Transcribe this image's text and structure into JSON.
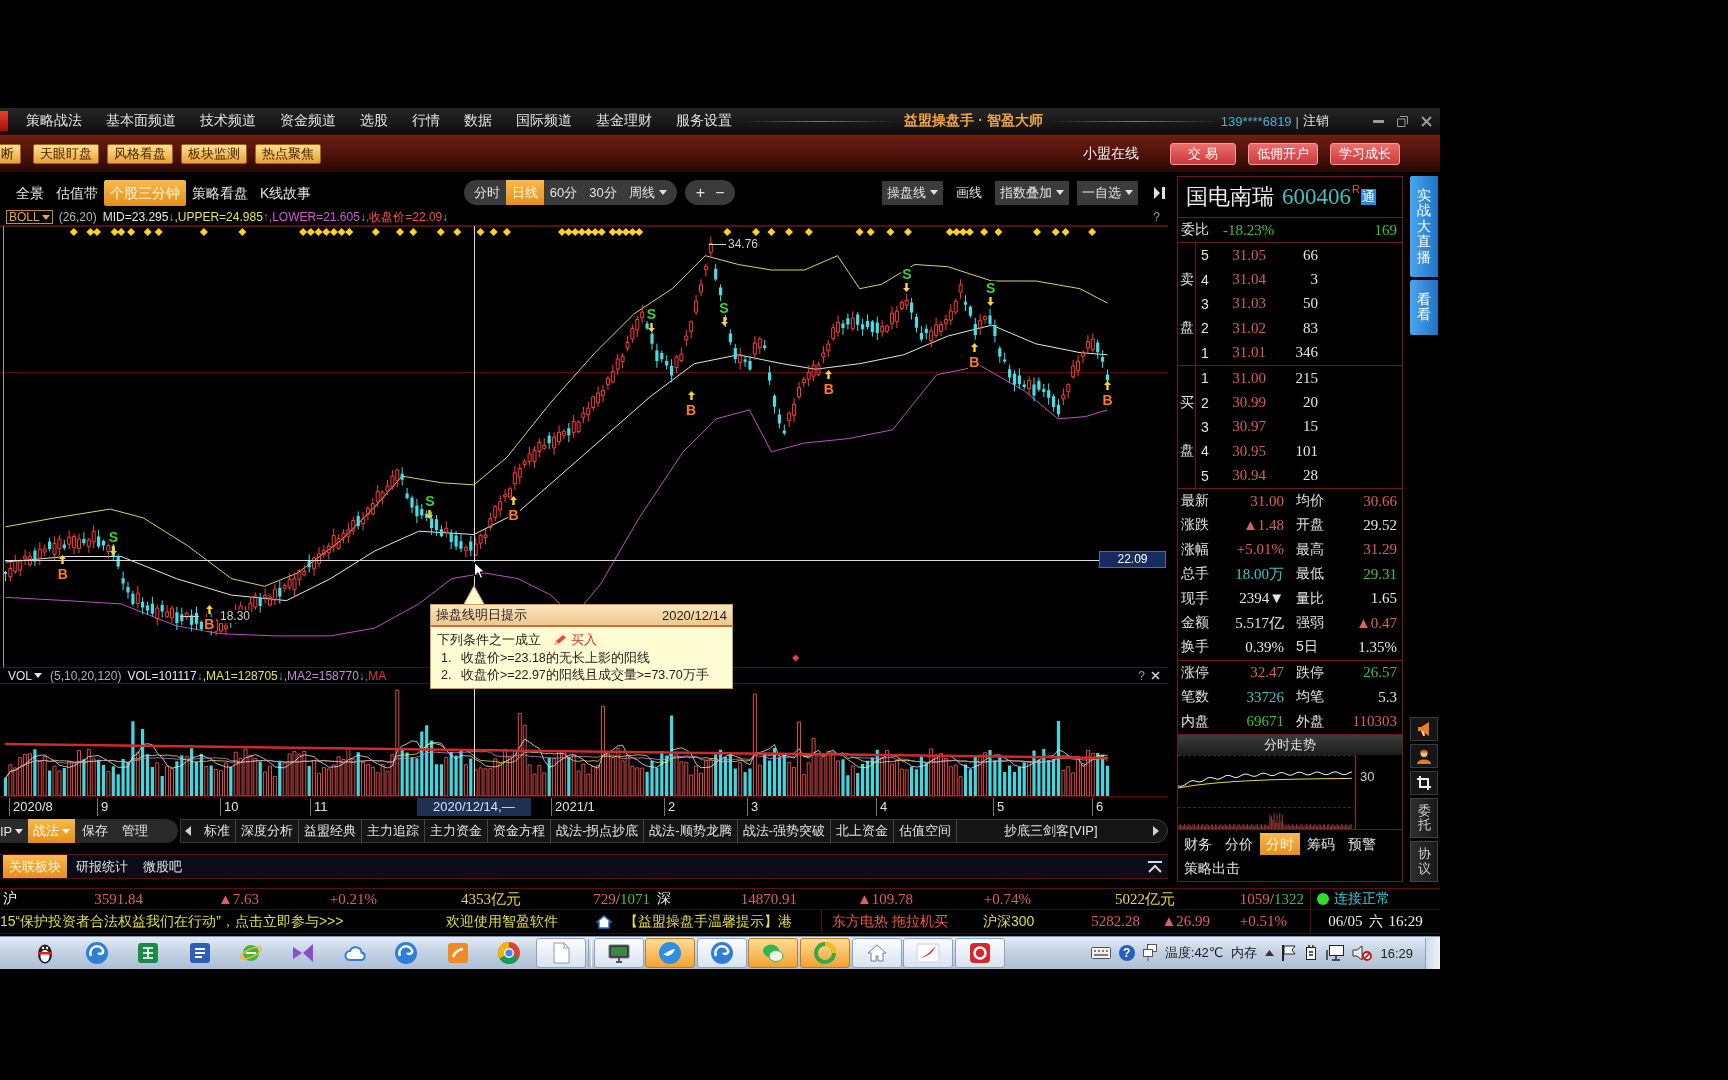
{
  "title_bar": {
    "menu": [
      "策略战法",
      "基本面频道",
      "技术频道",
      "资金频道",
      "选股",
      "行情",
      "数据",
      "国际频道",
      "基金理财",
      "服务设置"
    ],
    "title": "益盟操盘手 · 智盈大师",
    "account": "139****6819",
    "separator": "|",
    "logout": "注销"
  },
  "toolbar": {
    "left_buttons": [
      "断",
      "天眼盯盘",
      "风格看盘",
      "板块监测",
      "热点聚焦"
    ],
    "status": "小盟在线",
    "right_buttons": [
      "交 易",
      "低佣开户",
      "学习成长"
    ]
  },
  "view_tabs": [
    {
      "label": "全景",
      "selected": false
    },
    {
      "label": "估值带",
      "selected": false
    },
    {
      "label": "个股三分钟",
      "selected": true
    },
    {
      "label": "策略看盘",
      "selected": false
    },
    {
      "label": "K线故事",
      "selected": false
    }
  ],
  "period_tabs": [
    {
      "label": "分时",
      "selected": false,
      "dropdown": false
    },
    {
      "label": "日线",
      "selected": true,
      "dropdown": false
    },
    {
      "label": "60分",
      "selected": false,
      "dropdown": false
    },
    {
      "label": "30分",
      "selected": false,
      "dropdown": false
    },
    {
      "label": "周线",
      "selected": false,
      "dropdown": true
    }
  ],
  "zoom_buttons": [
    "+",
    "−"
  ],
  "chart_tools": [
    {
      "label": "操盘线",
      "dropdown": true
    },
    {
      "label": "画线",
      "dropdown": false
    },
    {
      "label": "指数叠加",
      "dropdown": true
    },
    {
      "label": "一自选",
      "dropdown": true
    }
  ],
  "indicator": {
    "name": "BOLL",
    "params": "(26,20)",
    "values": [
      {
        "text": "MID=23.295",
        "arrow": "↓",
        "rising": false,
        "color": "#e8e8e8"
      },
      {
        "text": ",UPPER=24.985",
        "arrow": "↑",
        "rising": true,
        "color": "#e6e35a"
      },
      {
        "text": ",LOWER=21.605",
        "arrow": "↓",
        "rising": false,
        "color": "#d35bd3"
      },
      {
        "text": ",收盘价=22.09",
        "arrow": "↓",
        "rising": false,
        "color": "#ff4a4a"
      }
    ],
    "help": "?"
  },
  "price_chart": {
    "high_label": "34.76",
    "low_label": "18.30",
    "crosshair_price": "22.09",
    "signals": [
      {
        "kind": "buy",
        "label": "B"
      },
      {
        "kind": "sell",
        "label": "S"
      },
      {
        "kind": "buy",
        "label": "B"
      },
      {
        "kind": "sell",
        "label": "S"
      },
      {
        "kind": "buy",
        "label": "B"
      },
      {
        "kind": "sell",
        "label": "S"
      },
      {
        "kind": "buy",
        "label": "B"
      },
      {
        "kind": "sell",
        "label": "S"
      },
      {
        "kind": "buy",
        "label": "B"
      },
      {
        "kind": "sell",
        "label": "S"
      },
      {
        "kind": "buy",
        "label": "B"
      },
      {
        "kind": "sell",
        "label": "S"
      },
      {
        "kind": "buy",
        "label": "B"
      }
    ]
  },
  "tooltip": {
    "title": "操盘线明日提示",
    "date": "2020/12/14",
    "condition": "下列条件之一成立",
    "action": "买入",
    "rules": [
      {
        "number": "1.",
        "text": "收盘价>=23.18的无长上影的阳线"
      },
      {
        "number": "2.",
        "text": "收盘价>=22.97的阳线且成交量>=73.70万手"
      }
    ]
  },
  "volume_indicator": {
    "name": "VOL",
    "params": "(5,10,20,120)",
    "values": [
      {
        "text": "VOL=101117",
        "arrow": "↓",
        "rising": false,
        "color": "#e8e8e8"
      },
      {
        "text": ",MA1=128705",
        "arrow": "↓",
        "rising": false,
        "color": "#e6e35a"
      },
      {
        "text": ",MA2=158770",
        "arrow": "↓",
        "rising": false,
        "color": "#c58ad8"
      },
      {
        "text": ",MA",
        "color": "#d04040"
      }
    ],
    "help": "?"
  },
  "date_axis": [
    {
      "label": "2020/8",
      "highlighted": false
    },
    {
      "label": "9",
      "highlighted": false
    },
    {
      "label": "10",
      "highlighted": false
    },
    {
      "label": "11",
      "highlighted": false
    },
    {
      "label": "2020/12/14,—",
      "highlighted": true
    },
    {
      "label": "2021/1",
      "highlighted": false
    },
    {
      "label": "2",
      "highlighted": false
    },
    {
      "label": "3",
      "highlighted": false
    },
    {
      "label": "4",
      "highlighted": false
    },
    {
      "label": "5",
      "highlighted": false
    },
    {
      "label": "6",
      "highlighted": false
    }
  ],
  "strategy_bar": {
    "modes": [
      {
        "label": "IP",
        "selected": false,
        "dropdown": true
      },
      {
        "label": "战法",
        "selected": true,
        "dropdown": true
      }
    ],
    "actions": [
      "保存",
      "管理"
    ],
    "tabs": [
      {
        "label": "标准",
        "selected": false
      },
      {
        "label": "深度分析",
        "selected": false
      },
      {
        "label": "益盟经典",
        "selected": false
      },
      {
        "label": "主力追踪",
        "selected": false
      },
      {
        "label": "主力资金",
        "selected": false
      },
      {
        "label": "资金方程",
        "selected": false
      },
      {
        "label": "战法-拐点抄底",
        "selected": false
      },
      {
        "label": "战法-顺势龙腾",
        "selected": false
      },
      {
        "label": "战法-强势突破",
        "selected": false
      },
      {
        "label": "北上资金",
        "selected": false
      },
      {
        "label": "估值空间",
        "selected": false
      },
      {
        "label": "抄底三剑客[VIP]",
        "selected": false
      }
    ]
  },
  "bottom_tabs": [
    {
      "label": "关联板块",
      "selected": true
    },
    {
      "label": "研报统计",
      "selected": false
    },
    {
      "label": "微股吧",
      "selected": false
    }
  ],
  "quote_panel": {
    "name": "国电南瑞",
    "code": "600406",
    "superscript": "R",
    "badge": "通",
    "ratio": {
      "label": "委比",
      "value": "-18.23%",
      "diff": "169",
      "rising": false
    },
    "sell_label": [
      "卖",
      "盘"
    ],
    "asks": [
      {
        "rank": "5",
        "price": "31.05",
        "volume": "66"
      },
      {
        "rank": "4",
        "price": "31.04",
        "volume": "3"
      },
      {
        "rank": "3",
        "price": "31.03",
        "volume": "50"
      },
      {
        "rank": "2",
        "price": "31.02",
        "volume": "83"
      },
      {
        "rank": "1",
        "price": "31.01",
        "volume": "346"
      }
    ],
    "buy_label": [
      "买",
      "盘"
    ],
    "bids": [
      {
        "rank": "1",
        "price": "31.00",
        "volume": "215"
      },
      {
        "rank": "2",
        "price": "30.99",
        "volume": "20"
      },
      {
        "rank": "3",
        "price": "30.97",
        "volume": "15"
      },
      {
        "rank": "4",
        "price": "30.95",
        "volume": "101"
      },
      {
        "rank": "5",
        "price": "30.94",
        "volume": "28"
      }
    ],
    "stats": [
      {
        "label": "最新",
        "value": "31.00",
        "color": "#e35d5d"
      },
      {
        "label": "均价",
        "value": "30.66",
        "color": "#e35d5d"
      },
      {
        "label": "涨跌",
        "value": "▲1.48",
        "color": "#e35d5d"
      },
      {
        "label": "开盘",
        "value": "29.52",
        "color": "#e6e6e6"
      },
      {
        "label": "涨幅",
        "value": "+5.01%",
        "color": "#e35d5d"
      },
      {
        "label": "最高",
        "value": "31.29",
        "color": "#e35d5d"
      },
      {
        "label": "总手",
        "value": "18.00万",
        "color": "#3fc6c6"
      },
      {
        "label": "最低",
        "value": "29.31",
        "color": "#3ec23e"
      },
      {
        "label": "现手",
        "value": "2394▼",
        "color": "#e6e6e6"
      },
      {
        "label": "量比",
        "value": "1.65",
        "color": "#e6e6e6"
      },
      {
        "label": "金额",
        "value": "5.517亿",
        "color": "#e6e6e6"
      },
      {
        "label": "强弱",
        "value": "▲0.47",
        "color": "#e35d5d"
      },
      {
        "label": "换手",
        "value": "0.39%",
        "color": "#e6e6e6"
      },
      {
        "label": "5日",
        "value": "1.35%",
        "color": "#e6e6e6"
      }
    ],
    "limits": [
      {
        "label": "涨停",
        "value": "32.47",
        "color": "#e35d5d"
      },
      {
        "label": "跌停",
        "value": "26.57",
        "color": "#3ec23e"
      },
      {
        "label": "笔数",
        "value": "33726",
        "color": "#3fc6c6"
      },
      {
        "label": "均笔",
        "value": "5.3",
        "color": "#e6e6e6"
      },
      {
        "label": "内盘",
        "value": "69671",
        "color": "#3ec23e"
      },
      {
        "label": "外盘",
        "value": "110303",
        "color": "#e35d5d"
      }
    ],
    "trend_title": "分时走势",
    "trend_axis": "30",
    "tabs": [
      {
        "label": "财务",
        "selected": false
      },
      {
        "label": "分价",
        "selected": false
      },
      {
        "label": "分时",
        "selected": true
      },
      {
        "label": "筹码",
        "selected": false
      },
      {
        "label": "预警",
        "selected": false
      },
      {
        "label": "策略出击",
        "selected": false
      }
    ]
  },
  "side_strip": {
    "promos": [
      "实战大直播",
      "看看"
    ],
    "buttons": [
      "委托",
      "协议"
    ]
  },
  "market_bar": {
    "markets": [
      {
        "name": "沪",
        "index": "3591.84",
        "change": "▲7.63",
        "percent": "+0.21%",
        "turnover": "4353亿元",
        "advances": "729",
        "slash": "/",
        "declines": "1071",
        "rising": true
      },
      {
        "name": "深",
        "index": "14870.91",
        "change": "▲109.78",
        "percent": "+0.74%",
        "turnover": "5022亿元",
        "advances": "1059",
        "slash": "/",
        "declines": "1322",
        "rising": true
      }
    ],
    "connection": {
      "text": "连接正常",
      "online": true
    }
  },
  "ticker": {
    "notices": [
      "15“保护投资者合法权益我们在行动”，点击立即参与>>>",
      "欢迎使用智盈软件",
      "【益盟操盘手温馨提示】港"
    ],
    "news": "东方电热 拖拉机买",
    "index": {
      "name": "沪深300",
      "value": "5282.28",
      "change": "▲26.99",
      "percent": "+0.51%",
      "rising": true
    },
    "clock": {
      "date": "06/05",
      "weekday": "六",
      "time": "16:29"
    }
  },
  "taskbar": {
    "apps": [
      {
        "kind": "penguin",
        "running": false,
        "flashing": false
      },
      {
        "kind": "swirl",
        "running": false,
        "flashing": false
      },
      {
        "kind": "spreadsheet",
        "running": false,
        "flashing": false
      },
      {
        "kind": "document",
        "running": false,
        "flashing": false
      },
      {
        "kind": "orbit",
        "running": false,
        "flashing": false
      },
      {
        "kind": "ribbon",
        "running": false,
        "flashing": false
      },
      {
        "kind": "cloud",
        "running": false,
        "flashing": false
      },
      {
        "kind": "swirl",
        "running": false,
        "flashing": false
      },
      {
        "kind": "tile",
        "running": false,
        "flashing": false
      },
      {
        "kind": "segmented",
        "running": false,
        "flashing": false
      },
      {
        "kind": "page",
        "running": true,
        "flashing": false
      },
      {
        "kind": "monitor",
        "running": true,
        "flashing": false
      },
      {
        "kind": "bird",
        "running": false,
        "flashing": true
      },
      {
        "kind": "swirl",
        "running": true,
        "flashing": false
      },
      {
        "kind": "chat",
        "running": false,
        "flashing": true
      },
      {
        "kind": "ring",
        "running": false,
        "flashing": true
      },
      {
        "kind": "house",
        "running": true,
        "flashing": false
      },
      {
        "kind": "swoosh",
        "running": true,
        "flashing": false
      },
      {
        "kind": "ringtile",
        "running": true,
        "flashing": false
      }
    ],
    "help": "?",
    "tray": [
      "温度:42℃",
      "内存"
    ],
    "time": "16:29"
  }
}
